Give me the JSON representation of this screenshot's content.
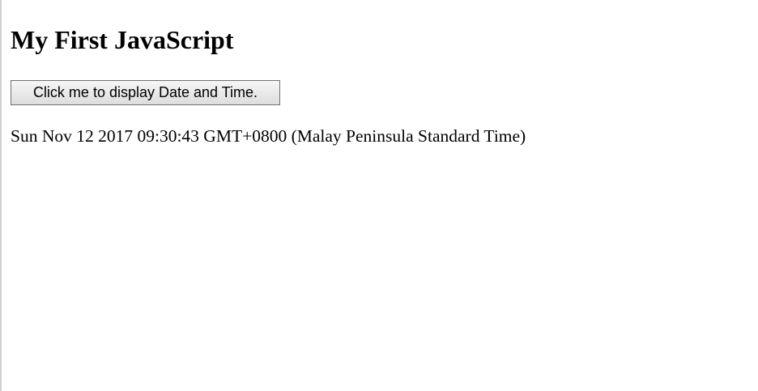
{
  "heading": "My First JavaScript",
  "button_label": "Click me to display Date and Time.",
  "output_text": "Sun Nov 12 2017 09:30:43 GMT+0800 (Malay Peninsula Standard Time)"
}
